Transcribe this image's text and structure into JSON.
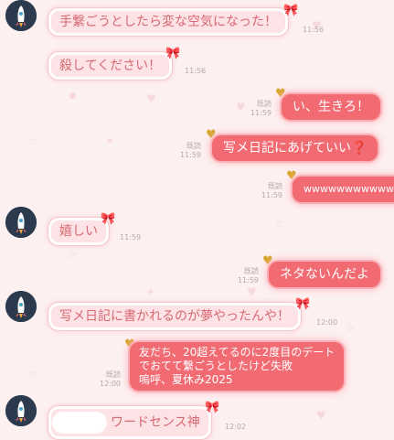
{
  "messages": [
    {
      "dir": "in",
      "text": "手繋ごうとしたら変な空気になった！",
      "time": "11:56"
    },
    {
      "dir": "in",
      "text": "殺してください！",
      "time": "11:56"
    },
    {
      "dir": "out",
      "text": "い、生きろ！",
      "read": "既読",
      "time": "11:59"
    },
    {
      "dir": "out",
      "text": "写メ日記にあげていい",
      "emoji": "❓",
      "read": "既読",
      "time": "11:59"
    },
    {
      "dir": "out",
      "text": "wwwwwwwwwww",
      "read": "既読",
      "time": "11:59"
    },
    {
      "dir": "in",
      "text": "嬉しい",
      "time": "11:59"
    },
    {
      "dir": "out",
      "text": "ネタないんだよ",
      "read": "既読",
      "time": "11:59"
    },
    {
      "dir": "in",
      "text": "写メ日記に書かれるのが夢やったんや！",
      "time": "12:00"
    },
    {
      "dir": "out",
      "lines": [
        "友だち、20超えてるのに2度目のデート",
        "でおてて繋ごうとしたけど失敗",
        "嗚呼、夏休み2025"
      ],
      "read": "既読",
      "time": "12:00"
    },
    {
      "dir": "in",
      "text": "ワードセンス神",
      "time": "12:02"
    }
  ],
  "icons": {
    "avatar": "rocket-avatar",
    "ribbon": "ribbon-icon",
    "badge": "heart-badge-icon"
  },
  "colors": {
    "background": "#fdf0f1",
    "incoming": "#fde3e5",
    "outgoing": "#f26b73",
    "incoming_text": "#d66a72"
  }
}
